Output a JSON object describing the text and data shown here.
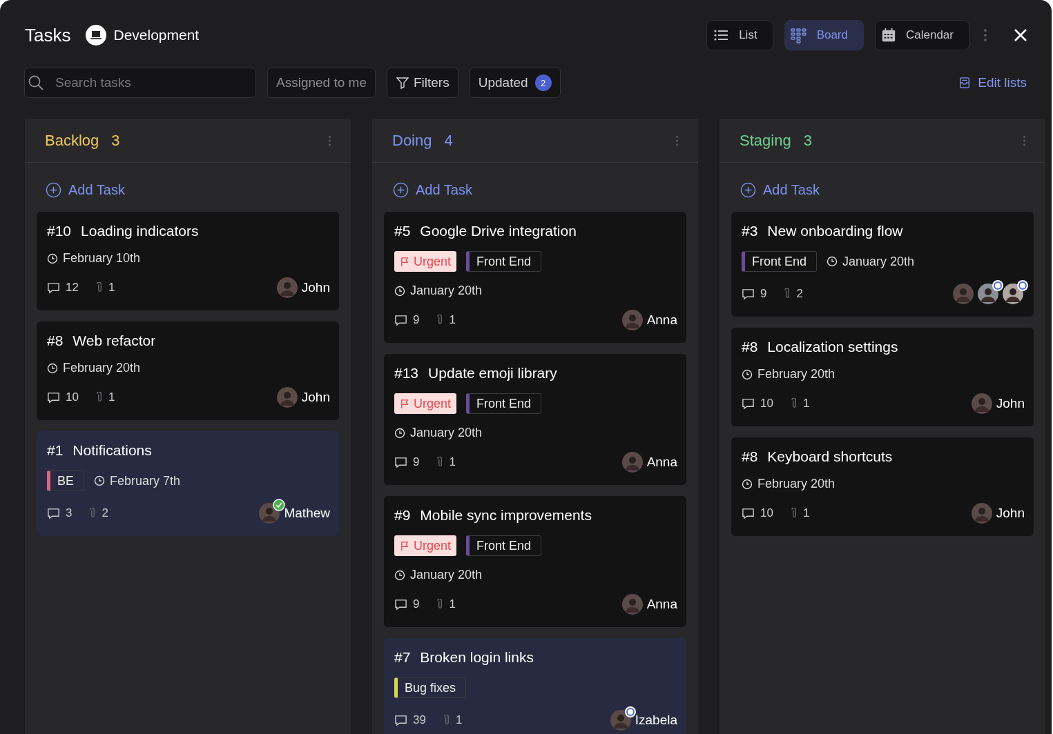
{
  "header": {
    "title": "Tasks",
    "project": "Development"
  },
  "views": [
    {
      "label": "List",
      "kind": "list",
      "selected": false
    },
    {
      "label": "Board",
      "kind": "board",
      "selected": true
    },
    {
      "label": "Calendar",
      "kind": "calendar",
      "selected": false
    }
  ],
  "toolbar": {
    "search": {
      "placeholder": "Search tasks"
    },
    "assigned": "Assigned to me",
    "filters": "Filters",
    "updated": {
      "label": "Updated",
      "count": "2"
    },
    "edit_lists": "Edit lists"
  },
  "columns": [
    {
      "name": "Backlog",
      "count": "3",
      "color": "#f0c85a",
      "add_label": "Add Task",
      "cards": [
        {
          "number": "#10",
          "title": "Loading indicators",
          "selected": false,
          "due": "February 10th",
          "comments": "12",
          "attachments": "1",
          "assignees": [
            {
              "name": "John",
              "kind": "plain"
            }
          ]
        },
        {
          "number": "#8",
          "title": "Web refactor",
          "selected": false,
          "due": "February 20th",
          "comments": "10",
          "attachments": "1",
          "assignees": [
            {
              "name": "John",
              "kind": "plain"
            }
          ]
        },
        {
          "number": "#1",
          "title": "Notifications",
          "selected": true,
          "date_beside_tags": true,
          "tags": [
            {
              "label": "BE",
              "kind": "tag",
              "color": "#d9667f"
            }
          ],
          "due": "February 7th",
          "comments": "3",
          "attachments": "2",
          "assignees": [
            {
              "name": "Mathew",
              "kind": "done"
            }
          ]
        }
      ]
    },
    {
      "name": "Doing",
      "count": "4",
      "color": "#7e92f2",
      "add_label": "Add Task",
      "cards": [
        {
          "number": "#5",
          "title": "Google Drive integration",
          "selected": false,
          "date_beside_tags": false,
          "tags": [
            {
              "label": "Urgent",
              "kind": "urgent",
              "color": "#e5484d"
            },
            {
              "label": "Front End",
              "kind": "tag",
              "color": "#6a4c9c"
            }
          ],
          "due": "January 20th",
          "comments": "9",
          "attachments": "1",
          "assignees": [
            {
              "name": "Anna",
              "kind": "plain"
            }
          ]
        },
        {
          "number": "#13",
          "title": "Update emoji library",
          "selected": false,
          "date_beside_tags": false,
          "tags": [
            {
              "label": "Urgent",
              "kind": "urgent",
              "color": "#e5484d"
            },
            {
              "label": "Front End",
              "kind": "tag",
              "color": "#6a4c9c"
            }
          ],
          "due": "January 20th",
          "comments": "9",
          "attachments": "1",
          "assignees": [
            {
              "name": "Anna",
              "kind": "plain"
            }
          ]
        },
        {
          "number": "#9",
          "title": "Mobile sync improvements",
          "selected": false,
          "date_beside_tags": false,
          "tags": [
            {
              "label": "Urgent",
              "kind": "urgent",
              "color": "#e5484d"
            },
            {
              "label": "Front End",
              "kind": "tag",
              "color": "#6a4c9c"
            }
          ],
          "due": "January 20th",
          "comments": "9",
          "attachments": "1",
          "assignees": [
            {
              "name": "Anna",
              "kind": "plain"
            }
          ]
        },
        {
          "number": "#7",
          "title": "Broken login links",
          "selected": true,
          "tags": [
            {
              "label": "Bug fixes",
              "kind": "tag",
              "color": "#d6d94e"
            }
          ],
          "comments": "39",
          "attachments": "1",
          "assignees": [
            {
              "name": "Izabela",
              "kind": "pending"
            }
          ]
        }
      ]
    },
    {
      "name": "Staging",
      "count": "3",
      "color": "#6fcf8f",
      "add_label": "Add Task",
      "cards": [
        {
          "number": "#3",
          "title": "New onboarding flow",
          "selected": false,
          "date_beside_tags": true,
          "tags": [
            {
              "label": "Front End",
              "kind": "tag",
              "color": "#6a4c9c"
            }
          ],
          "due": "January 20th",
          "comments": "9",
          "attachments": "2",
          "assignees": [
            {
              "kind": "plain"
            },
            {
              "kind": "pending"
            },
            {
              "kind": "pending"
            }
          ]
        },
        {
          "number": "#8",
          "title": "Localization settings",
          "selected": false,
          "due": "February 20th",
          "comments": "10",
          "attachments": "1",
          "assignees": [
            {
              "name": "John",
              "kind": "plain"
            }
          ]
        },
        {
          "number": "#8",
          "title": "Keyboard shortcuts",
          "selected": false,
          "due": "February 20th",
          "comments": "10",
          "attachments": "1",
          "assignees": [
            {
              "name": "John",
              "kind": "plain"
            }
          ]
        }
      ]
    }
  ]
}
